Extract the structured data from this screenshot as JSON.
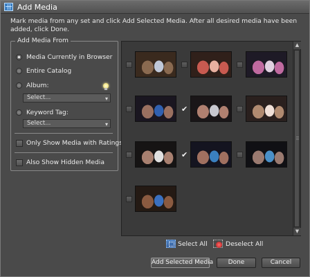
{
  "window": {
    "title": "Add Media",
    "instructions": "Mark media from any set and click Add Selected Media. After all desired media have been added, click Done."
  },
  "add_from": {
    "legend": "Add Media From",
    "options": [
      {
        "label": "Media Currently in Browser",
        "selected": true
      },
      {
        "label": "Entire Catalog",
        "selected": false
      },
      {
        "label": "Album:",
        "selected": false
      },
      {
        "label": "Keyword Tag:",
        "selected": false
      }
    ],
    "album_select": {
      "value": "Select..."
    },
    "keyword_select": {
      "value": "Select..."
    },
    "only_ratings": {
      "label": "Only Show Media with Ratings",
      "checked": false
    },
    "show_hidden": {
      "label": "Also Show Hidden Media",
      "checked": false
    }
  },
  "thumbnails": [
    {
      "checked": false,
      "colors": [
        "#3a2a1e",
        "#8a6a50",
        "#c0c8d8"
      ]
    },
    {
      "checked": false,
      "colors": [
        "#30201a",
        "#c85a50",
        "#e8b0a0"
      ]
    },
    {
      "checked": false,
      "colors": [
        "#1e1a26",
        "#c06aa0",
        "#e0d0e0"
      ]
    },
    {
      "checked": false,
      "colors": [
        "#1a1620",
        "#9a7060",
        "#3060b0"
      ]
    },
    {
      "checked": true,
      "colors": [
        "#1a1618",
        "#b08070",
        "#c8c8d0"
      ]
    },
    {
      "checked": false,
      "colors": [
        "#2a201e",
        "#b08a70",
        "#f0e0d8"
      ]
    },
    {
      "checked": false,
      "colors": [
        "#161414",
        "#a88070",
        "#e0e0e0"
      ]
    },
    {
      "checked": true,
      "colors": [
        "#141420",
        "#a07060",
        "#3a80c0"
      ]
    },
    {
      "checked": false,
      "colors": [
        "#101014",
        "#9a7a70",
        "#4a90c8"
      ]
    },
    {
      "checked": false,
      "colors": [
        "#241a14",
        "#8a5a40",
        "#3a70c0"
      ]
    }
  ],
  "selection": {
    "select_all": "Select All",
    "deselect_all": "Deselect All"
  },
  "buttons": {
    "add_selected": "Add Selected Media",
    "done": "Done",
    "cancel": "Cancel"
  },
  "colors": {
    "dialog_bg": "#4a4a4a",
    "grid_bg": "#3a3a3a",
    "accent": "#3a63a0"
  }
}
